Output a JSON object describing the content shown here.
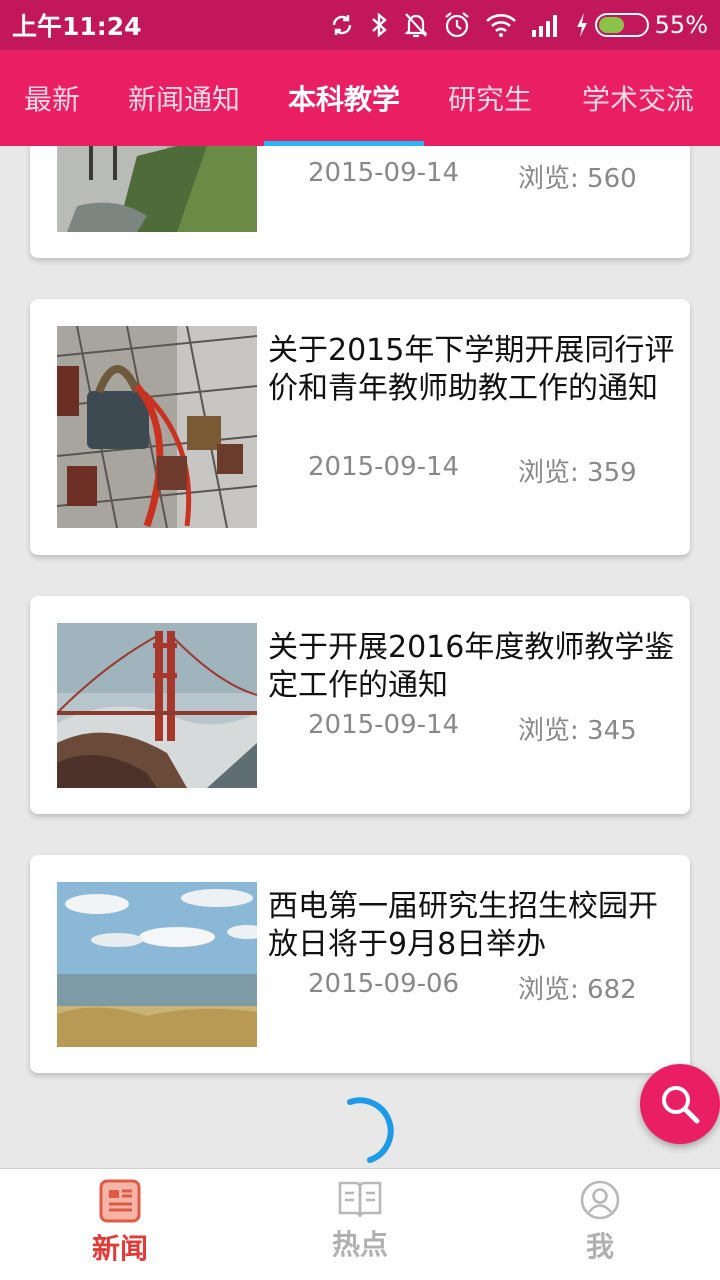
{
  "status_bar": {
    "time": "上午11:24",
    "battery_percent": "55%",
    "battery_level": 0.55,
    "icons": [
      "sync-icon",
      "bluetooth-icon",
      "mute-icon",
      "alarm-icon",
      "wifi-icon",
      "signal-icon",
      "charging-icon",
      "battery-icon"
    ]
  },
  "tabs": [
    {
      "label": "最新"
    },
    {
      "label": "新闻通知"
    },
    {
      "label": "本科教学",
      "active": true
    },
    {
      "label": "研究生"
    },
    {
      "label": "学术交流"
    }
  ],
  "articles": [
    {
      "title": "",
      "date": "2015-09-14",
      "views": "浏览: 560"
    },
    {
      "title": "关于2015年下学期开展同行评价和青年教师助教工作的通知",
      "date": "2015-09-14",
      "views": "浏览: 359"
    },
    {
      "title": "关于开展2016年度教师教学鉴定工作的通知",
      "date": "2015-09-14",
      "views": "浏览: 345"
    },
    {
      "title": "西电第一届研究生招生校园开放日将于9月8日举办",
      "date": "2015-09-06",
      "views": "浏览: 682"
    }
  ],
  "fab": {
    "icon": "search-icon"
  },
  "bottom_nav": [
    {
      "label": "新闻",
      "icon": "news-icon",
      "active": true
    },
    {
      "label": "热点",
      "icon": "book-icon"
    },
    {
      "label": "我",
      "icon": "user-icon"
    }
  ],
  "colors": {
    "status_bar": "#c2185b",
    "primary": "#e91e63",
    "tab_indicator": "#29b6f6",
    "nav_active": "#e53935",
    "nav_inactive": "#b0b0b0",
    "meta_text": "#888888"
  }
}
